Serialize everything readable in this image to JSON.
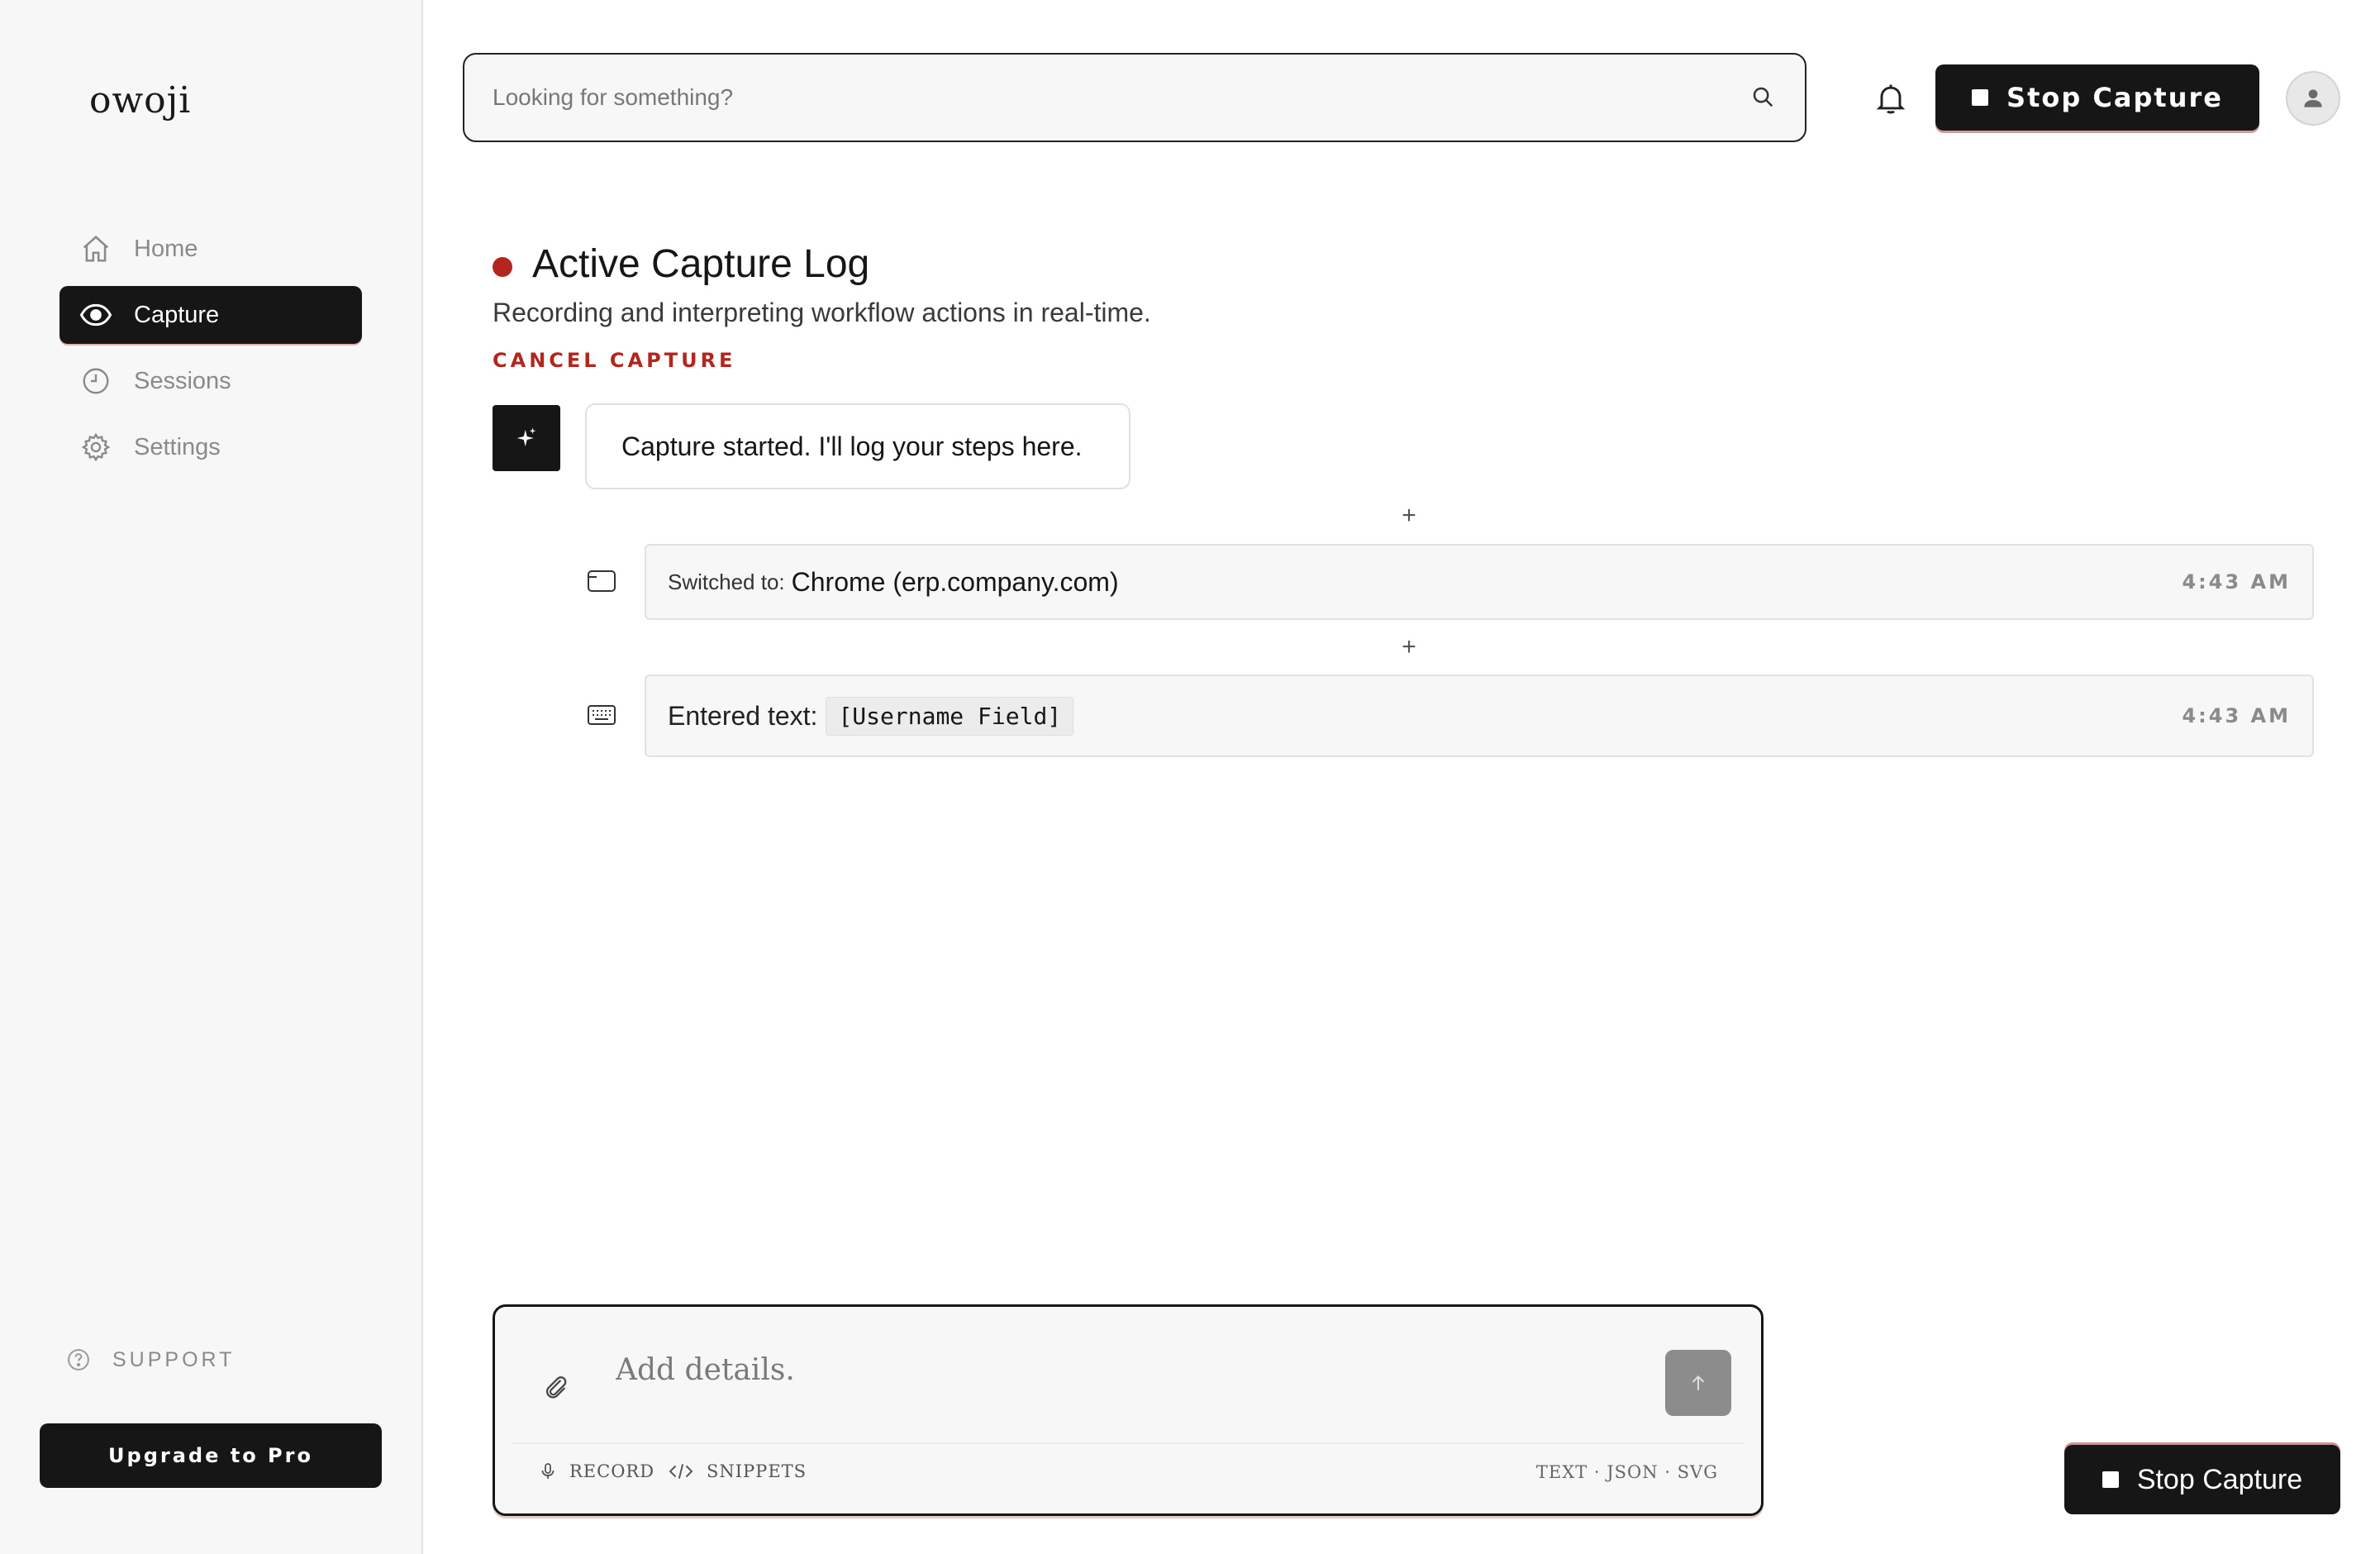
{
  "app": {
    "logo": "owoji"
  },
  "sidebar": {
    "items": [
      {
        "label": "Home",
        "icon": "home-icon",
        "active": false
      },
      {
        "label": "Capture",
        "icon": "eye-icon",
        "active": true
      },
      {
        "label": "Sessions",
        "icon": "clock-icon",
        "active": false
      },
      {
        "label": "Settings",
        "icon": "gear-icon",
        "active": false
      }
    ],
    "support_label": "SUPPORT",
    "upgrade_label": "Upgrade to Pro"
  },
  "header": {
    "search_placeholder": "Looking for something?",
    "stop_label": "Stop Capture"
  },
  "main": {
    "title": "Active Capture Log",
    "subtitle": "Recording and interpreting workflow actions in real-time.",
    "cancel_label": "CANCEL CAPTURE",
    "assistant_message": "Capture started. I'll log your steps here.",
    "steps": [
      {
        "type": "switch",
        "label": "Switched to:",
        "value": "Chrome (erp.company.com)",
        "time": "4:43 AM",
        "icon": "window-icon"
      },
      {
        "type": "text",
        "label": "Entered text:",
        "value": "[Username Field]",
        "time": "4:43 AM",
        "icon": "keyboard-icon"
      }
    ]
  },
  "composer": {
    "placeholder": "Add details.",
    "record_label": "RECORD",
    "snippets_label": "SNIPPETS",
    "formats": "TEXT · JSON · SVG"
  },
  "floating": {
    "stop_label": "Stop Capture"
  },
  "colors": {
    "accent": "#b3261e",
    "dark": "#161616",
    "sidebar_bg": "#f7f7f7"
  }
}
